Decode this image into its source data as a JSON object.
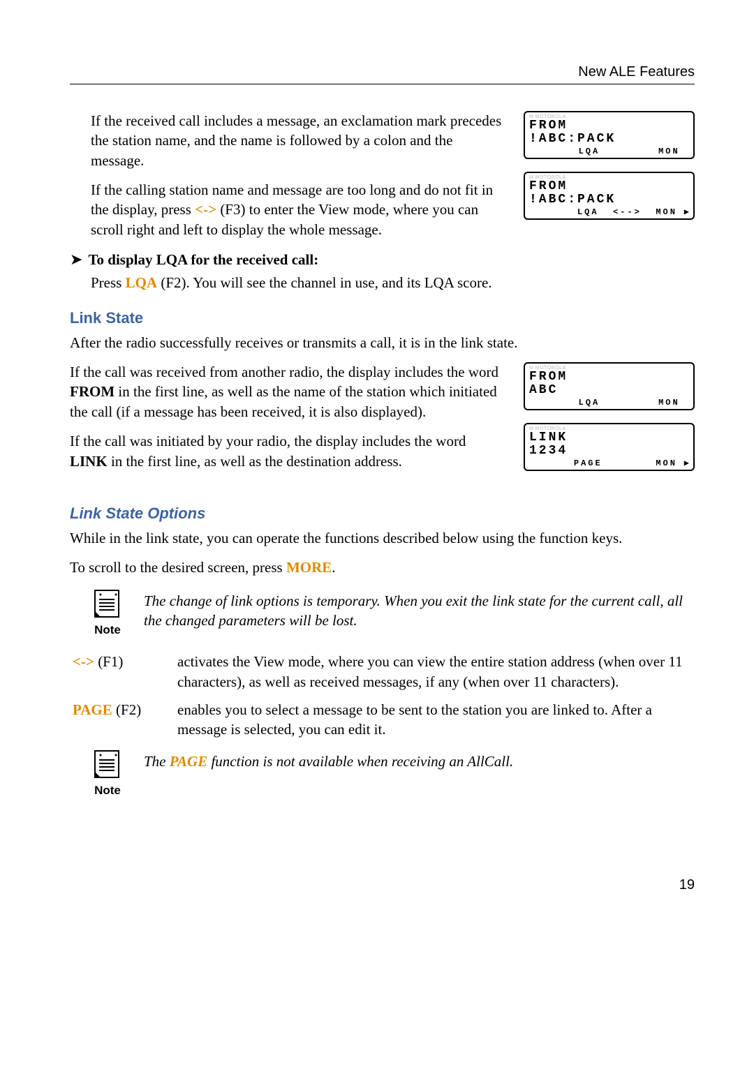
{
  "header": {
    "title": "New ALE Features"
  },
  "para1": "If the received call includes a message, an exclamation mark precedes the station name, and the name is followed by a colon and the message.",
  "para2a": "If the calling station name and message are too long and do not fit in the display, press ",
  "para2key": "<->",
  "para2b": " (F3) to enter the View mode, where you can scroll right and left to display the whole message.",
  "lcd1": {
    "l1": "FROM",
    "l2": "!ABC:PACK",
    "s1": "",
    "s2": "LQA",
    "s3": "",
    "s4": "MON"
  },
  "lcd2": {
    "l1": "FROM",
    "l2": "!ABC:PACK",
    "s1": "",
    "s2": "LQA",
    "s3": "<-->",
    "s4": "MON",
    "tri": "▶"
  },
  "proc1": {
    "title": "To display LQA for the received call:",
    "ba": "Press ",
    "key": "LQA",
    "bb": " (F2). You will see the channel in use, and its LQA score."
  },
  "h_linkstate": "Link State",
  "linkstate_intro": "After the radio successfully receives or transmits a call, it is in the link state.",
  "from_para_a": "If the call was received from another radio, the display includes the word ",
  "from_word": "FROM",
  "from_para_b": " in the first line, as well as the name of the station which initiated the call (if a message has been received, it is also displayed).",
  "link_para_a": "If the call was initiated by your radio, the display includes the word ",
  "link_word": "LINK",
  "link_para_b": " in the first line, as well as the destination address.",
  "lcd3": {
    "l1": "FROM",
    "l2": "ABC",
    "s1": "",
    "s2": "LQA",
    "s3": "",
    "s4": "MON"
  },
  "lcd4": {
    "l1": "LINK",
    "l2": "1234",
    "s1": "",
    "s2": "PAGE",
    "s3": "",
    "s4": "MON",
    "tri": "▶"
  },
  "h_opts": "Link State Options",
  "opts_p1": "While in the link state, you can operate the functions described below using the function keys.",
  "opts_p2a": "To scroll to the desired screen, press ",
  "opts_p2key": "MORE",
  "opts_p2b": ".",
  "note1": "The change of link options is temporary. When you exit the link state for the current call, all the changed parameters will be lost.",
  "note_label": "Note",
  "defs": {
    "k1a": "<->",
    "k1b": " (F1)",
    "v1": "activates the View mode, where you can view the entire station address (when over 11 characters), as well as received messages, if any (when over 11 characters).",
    "k2a": "PAGE",
    "k2b": " (F2)",
    "v2": "enables you to select a message to be sent to the station you are linked to. After a message is selected, you can edit it."
  },
  "note2a": "The ",
  "note2key": "PAGE",
  "note2b": " function is not available when receiving an AllCall.",
  "page_number": "19"
}
